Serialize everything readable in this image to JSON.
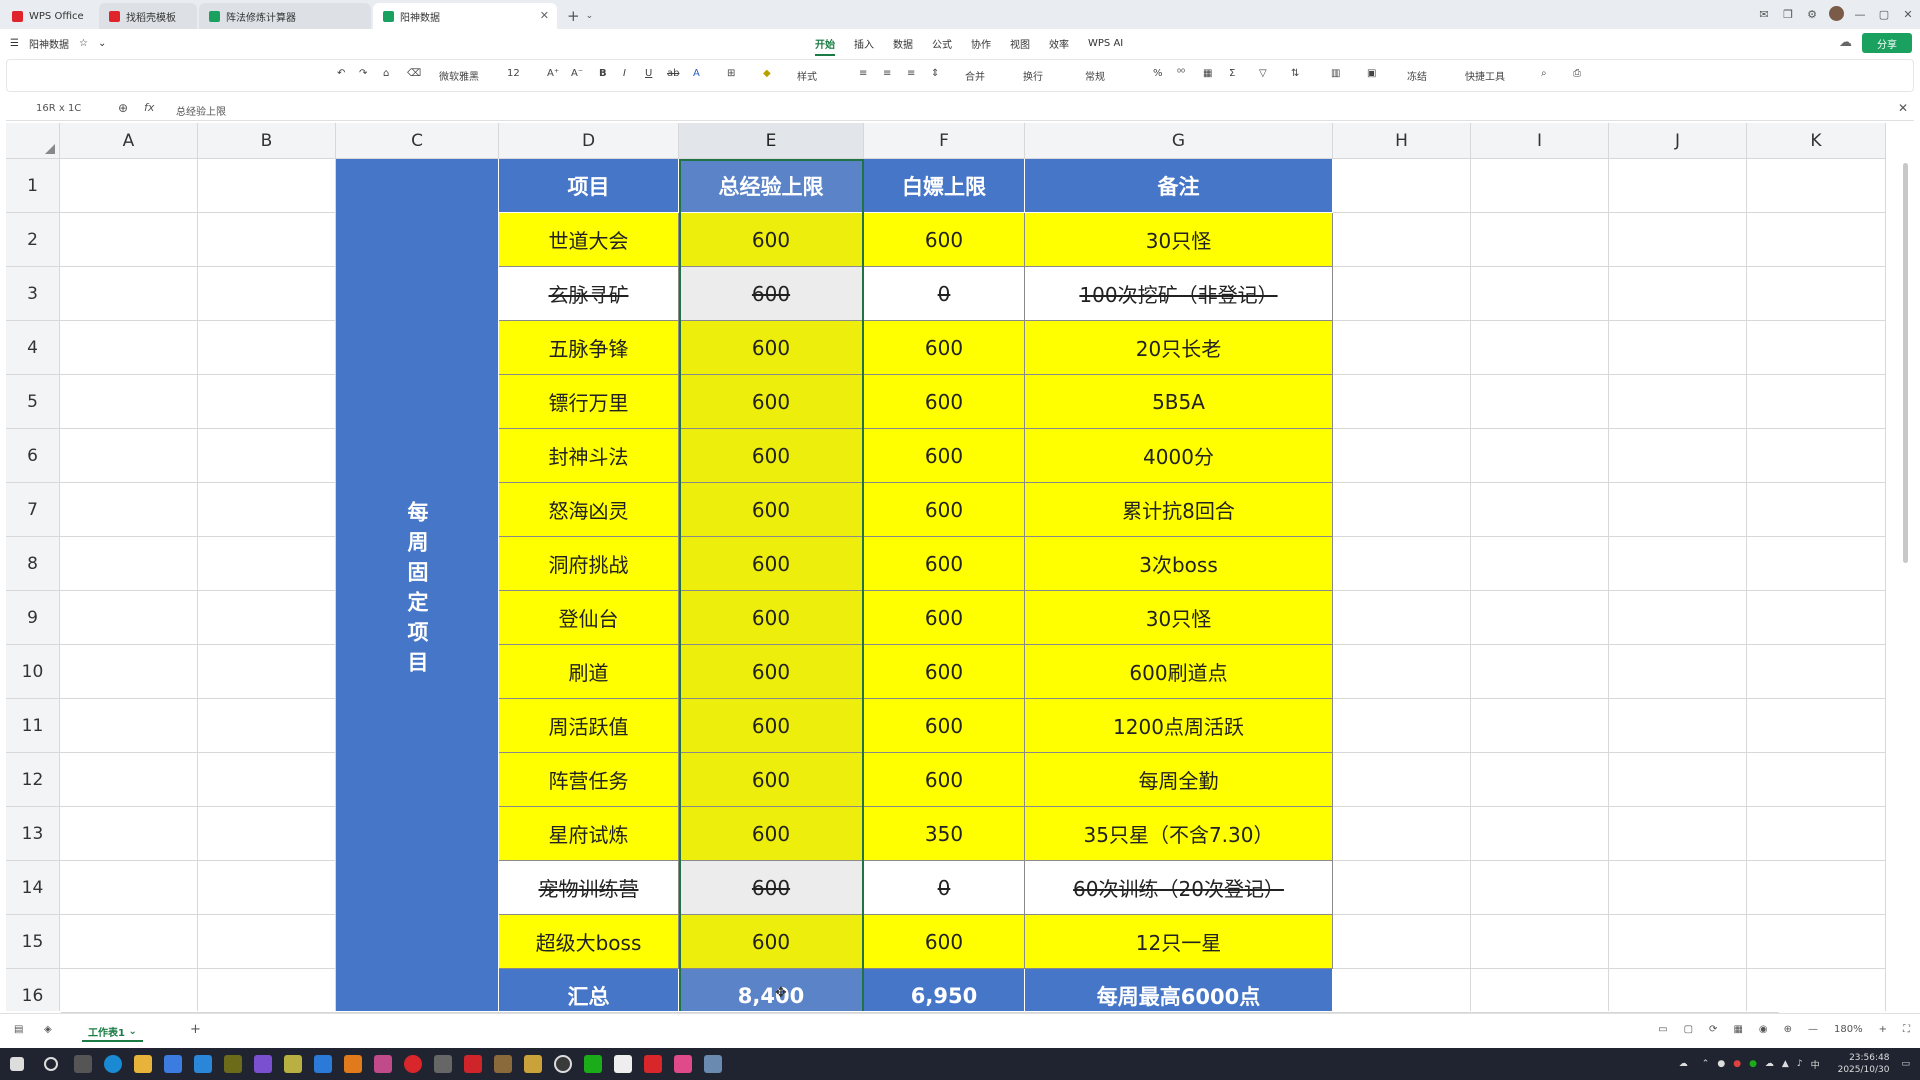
{
  "tabs": {
    "home": "WPS Office",
    "t1": "找稻壳模板",
    "t2": "阵法修炼计算器",
    "active": "阳神数据"
  },
  "menubar": {
    "filename": "阳神数据",
    "menus": [
      "开始",
      "插入",
      "数据",
      "公式",
      "协作",
      "视图",
      "效率",
      "WPS AI"
    ],
    "share": "分享"
  },
  "toolbar": {
    "font": "微软雅黑",
    "size": "12",
    "style": "样式",
    "merge": "合并",
    "wrap": "换行",
    "numfmt": "常规",
    "freeze": "冻结",
    "quicktools": "快捷工具"
  },
  "formula": {
    "namebox": "16R x 1C",
    "content": "总经验上限"
  },
  "columns": [
    "A",
    "B",
    "C",
    "D",
    "E",
    "F",
    "G",
    "H",
    "I",
    "J",
    "K"
  ],
  "rows": [
    "1",
    "2",
    "3",
    "4",
    "5",
    "6",
    "7",
    "8",
    "9",
    "10",
    "11",
    "12",
    "13",
    "14",
    "15",
    "16"
  ],
  "table": {
    "side_label": "每周固定项目",
    "headers": [
      "项目",
      "总经验上限",
      "白嫖上限",
      "备注"
    ],
    "rows": [
      {
        "name": "世道大会",
        "total": "600",
        "free": "600",
        "note": "30只怪",
        "strike": false
      },
      {
        "name": "玄脉寻矿",
        "total": "600",
        "free": "0",
        "note": "100次挖矿（非登记）",
        "strike": true
      },
      {
        "name": "五脉争锋",
        "total": "600",
        "free": "600",
        "note": "20只长老",
        "strike": false
      },
      {
        "name": "镖行万里",
        "total": "600",
        "free": "600",
        "note": "5B5A",
        "strike": false
      },
      {
        "name": "封神斗法",
        "total": "600",
        "free": "600",
        "note": "4000分",
        "strike": false
      },
      {
        "name": "怒海凶灵",
        "total": "600",
        "free": "600",
        "note": "累计抗8回合",
        "strike": false
      },
      {
        "name": "洞府挑战",
        "total": "600",
        "free": "600",
        "note": "3次boss",
        "strike": false
      },
      {
        "name": "登仙台",
        "total": "600",
        "free": "600",
        "note": "30只怪",
        "strike": false
      },
      {
        "name": "刷道",
        "total": "600",
        "free": "600",
        "note": "600刷道点",
        "strike": false
      },
      {
        "name": "周活跃值",
        "total": "600",
        "free": "600",
        "note": "1200点周活跃",
        "strike": false
      },
      {
        "name": "阵营任务",
        "total": "600",
        "free": "600",
        "note": "每周全勤",
        "strike": false
      },
      {
        "name": "星府试炼",
        "total": "600",
        "free": "350",
        "note": "35只星（不含7.30）",
        "strike": false
      },
      {
        "name": "宠物训练营",
        "total": "600",
        "free": "0",
        "note": "60次训练（20次登记）",
        "strike": true
      },
      {
        "name": "超级大boss",
        "total": "600",
        "free": "600",
        "note": "12只一星",
        "strike": false
      }
    ],
    "summary": {
      "name": "汇总",
      "total": "8,400",
      "free": "6,950",
      "note": "每周最高6000点"
    }
  },
  "sheetbar": {
    "sheet": "工作表1",
    "zoom": "180%"
  },
  "clock": {
    "time": "23:56:48",
    "date": "2025/10/30"
  },
  "colors": {
    "header_blue": "#4676c8",
    "cell_yellow": "#ffff00",
    "accent_green": "#1a7c44"
  }
}
